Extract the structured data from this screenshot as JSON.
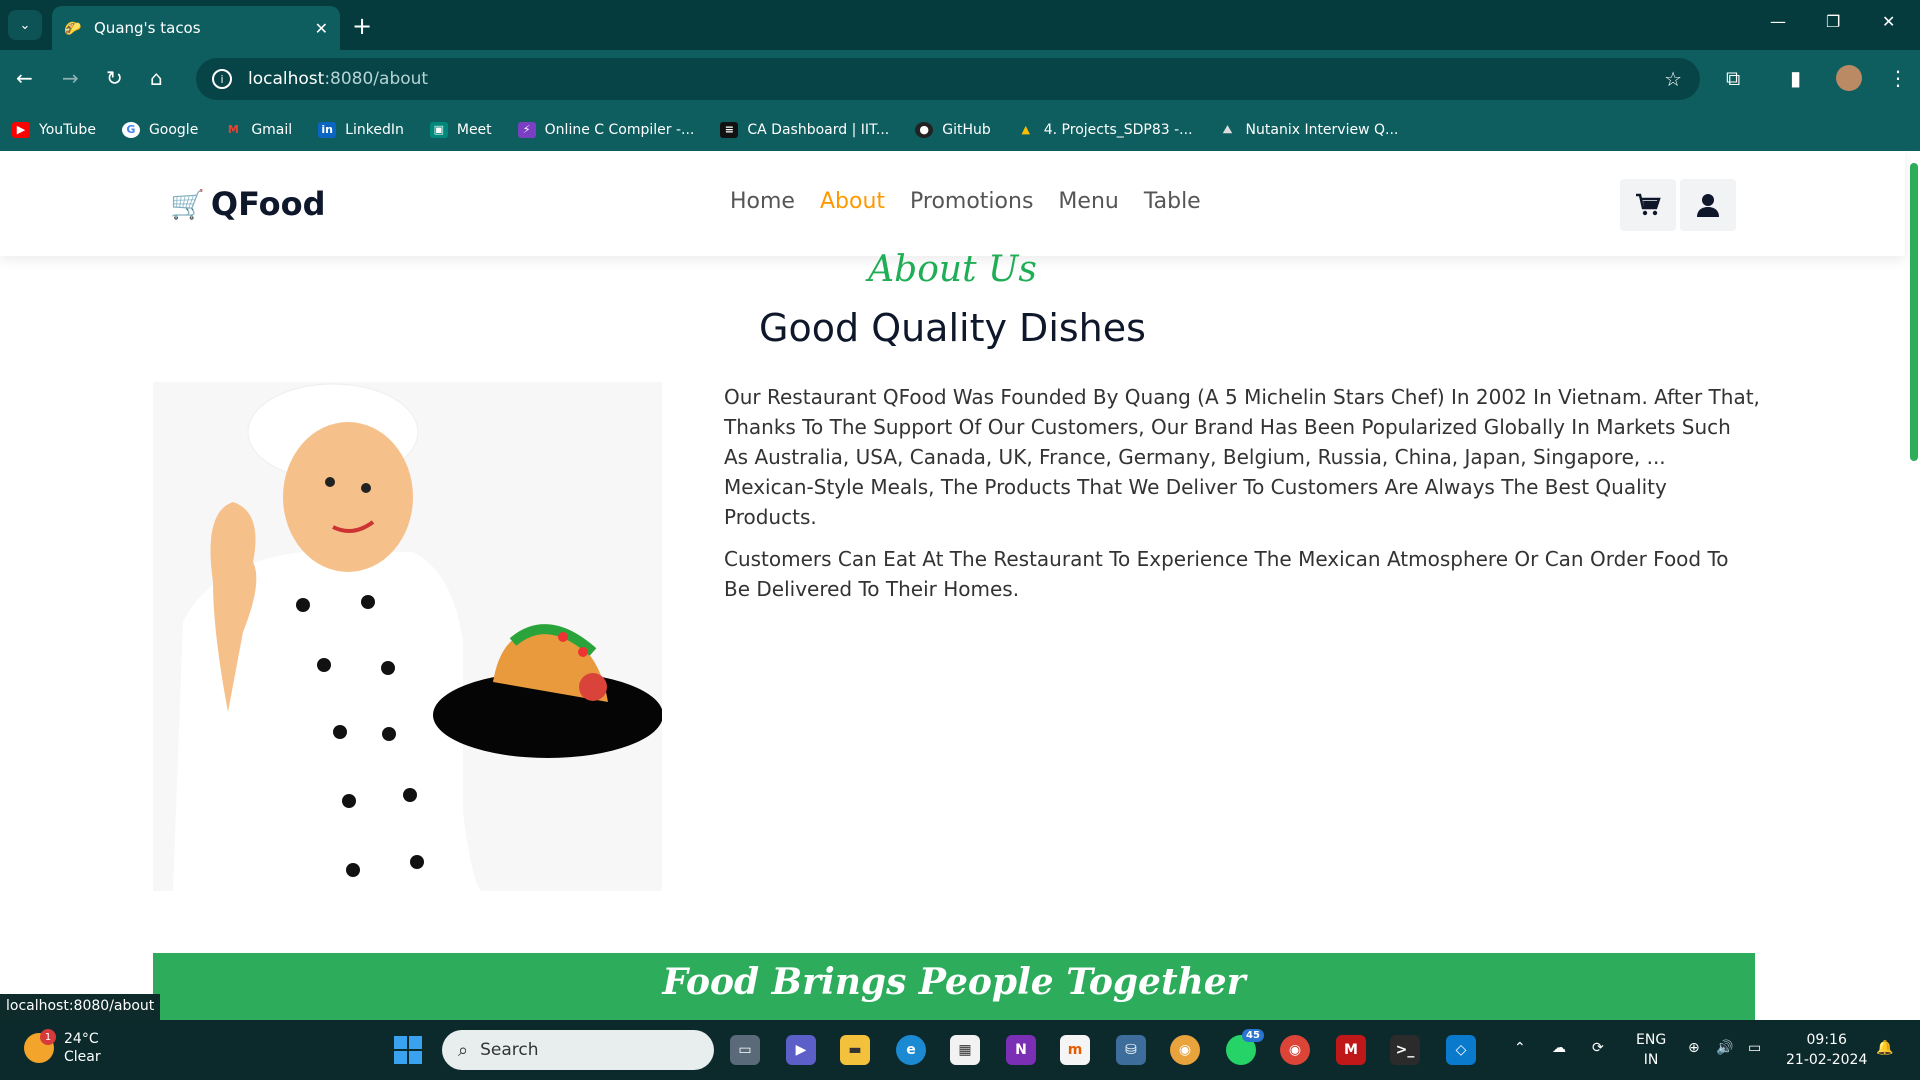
{
  "browser": {
    "tab_title": "Quang's tacos",
    "url_host": "localhost",
    "url_path": ":8080/about",
    "bookmarks": [
      {
        "label": "YouTube",
        "color": "#ff0000"
      },
      {
        "label": "Google",
        "color": "#ffffff"
      },
      {
        "label": "Gmail",
        "color": "#ea4335"
      },
      {
        "label": "LinkedIn",
        "color": "#0a66c2"
      },
      {
        "label": "Meet",
        "color": "#00897b"
      },
      {
        "label": "Online C Compiler -...",
        "color": "#7b3fc4"
      },
      {
        "label": "CA Dashboard | IIT...",
        "color": "#111111"
      },
      {
        "label": "GitHub",
        "color": "#222222"
      },
      {
        "label": "4. Projects_SDP83 -...",
        "color": "#fbbc04"
      },
      {
        "label": "Nutanix Interview Q...",
        "color": "#dddddd"
      }
    ]
  },
  "site": {
    "logo_text": "QFood",
    "nav": [
      {
        "label": "Home",
        "active": false
      },
      {
        "label": "About",
        "active": true
      },
      {
        "label": "Promotions",
        "active": false
      },
      {
        "label": "Menu",
        "active": false
      },
      {
        "label": "Table",
        "active": false
      }
    ],
    "accent_color": "#fe9900",
    "green": "#2dac5c"
  },
  "about": {
    "script_heading": "About Us",
    "title": "Good Quality Dishes",
    "paragraphs": [
      "Our Restaurant QFood Was Founded By Quang (A 5 Michelin Stars Chef) In 2002 In Vietnam. After That, Thanks To The Support Of Our Customers, Our Brand Has Been Popularized Globally In Markets Such As Australia, USA, Canada, UK, France, Germany, Belgium, Russia, China, Japan, Singapore, ... Mexican-Style Meals, The Products That We Deliver To Customers Are Always The Best Quality Products.",
      "Customers Can Eat At The Restaurant To Experience The Mexican Atmosphere Or Can Order Food To Be Delivered To Their Homes."
    ]
  },
  "banner": {
    "text": "Food Brings People Together"
  },
  "status_url": "localhost:8080/about",
  "taskbar": {
    "weather_temp": "24°C",
    "weather_desc": "Clear",
    "weather_badge": "1",
    "search_label": "Search",
    "whatsapp_badge": "45",
    "lang_line1": "ENG",
    "lang_line2": "IN",
    "time": "09:16",
    "date": "21-02-2024"
  }
}
